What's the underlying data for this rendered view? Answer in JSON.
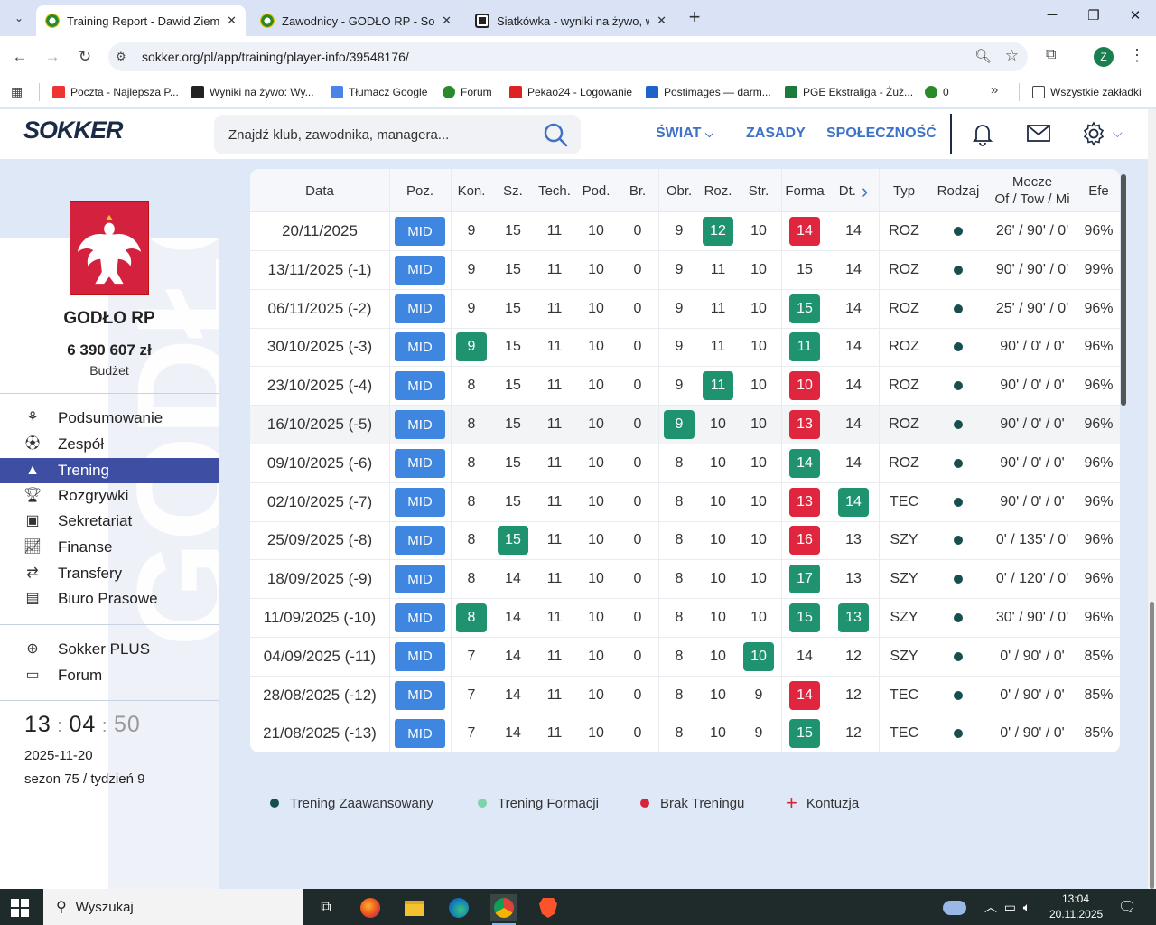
{
  "browser": {
    "tabs": [
      {
        "title": "Training Report - Dawid Ziemian",
        "active": true
      },
      {
        "title": "Zawodnicy - GODŁO RP - Sokker",
        "active": false
      },
      {
        "title": "Siatkówka - wyniki na żywo, wyn",
        "active": false
      }
    ],
    "url": "sokker.org/pl/app/training/player-info/39548176/",
    "profile_initial": "Z",
    "bookmarks": [
      "Poczta - Najlepsza P...",
      "Wyniki na żywo: Wy...",
      "Tłumacz Google",
      "Forum",
      "Pekao24 - Logowanie",
      "Postimages — darm...",
      "PGE Ekstraliga - Żuż...",
      "0"
    ],
    "all_bookmarks": "Wszystkie zakładki"
  },
  "header": {
    "logo": "SOKKER",
    "search_placeholder": "Znajdź klub, zawodnika, managera...",
    "nav": [
      "ŚWIAT",
      "ZASADY",
      "SPOŁECZNOŚĆ"
    ]
  },
  "sidebar": {
    "club_name": "GODŁO RP",
    "budget": "6 390 607 zł",
    "budget_label": "Budżet",
    "watermark": "GODŁO",
    "menu": [
      {
        "label": "Podsumowanie",
        "icon": "summary-icon"
      },
      {
        "label": "Zespół",
        "icon": "ball-icon"
      },
      {
        "label": "Trening",
        "icon": "cone-icon",
        "active": true
      },
      {
        "label": "Rozgrywki",
        "icon": "trophy-icon"
      },
      {
        "label": "Sekretariat",
        "icon": "briefcase-icon"
      },
      {
        "label": "Finanse",
        "icon": "chart-icon"
      },
      {
        "label": "Transfery",
        "icon": "arrows-icon"
      },
      {
        "label": "Biuro Prasowe",
        "icon": "newspaper-icon"
      }
    ],
    "menu2": [
      {
        "label": "Sokker PLUS",
        "icon": "plus-circle-icon"
      },
      {
        "label": "Forum",
        "icon": "chat-icon"
      }
    ],
    "clock": {
      "h": "13",
      "m": "04",
      "s": "50"
    },
    "date": "2025-11-20",
    "season": "sezon 75 / tydzień 9"
  },
  "table": {
    "headers": {
      "date": "Data",
      "pos": "Poz.",
      "kon": "Kon.",
      "sz": "Sz.",
      "tech": "Tech.",
      "pod": "Pod.",
      "br": "Br.",
      "obr": "Obr.",
      "roz": "Roz.",
      "str": "Str.",
      "forma": "Forma",
      "dt": "Dt.",
      "typ": "Typ",
      "rodzaj": "Rodzaj",
      "mecze1": "Mecze",
      "mecze2": "Of / Tow / Mi",
      "efe": "Efe"
    },
    "rows": [
      {
        "date": "20/11/2025",
        "pos": "MID",
        "kon": "9",
        "sz": "15",
        "tech": "11",
        "pod": "10",
        "br": "0",
        "obr": "9",
        "roz": "12",
        "str": "10",
        "forma": "14",
        "dt": "14",
        "typ": "ROZ",
        "mecze": "26' / 90' / 0'",
        "efe": "96%",
        "hl": {
          "roz": "g",
          "forma": "r"
        }
      },
      {
        "date": "13/11/2025 (-1)",
        "pos": "MID",
        "kon": "9",
        "sz": "15",
        "tech": "11",
        "pod": "10",
        "br": "0",
        "obr": "9",
        "roz": "11",
        "str": "10",
        "forma": "15",
        "dt": "14",
        "typ": "ROZ",
        "mecze": "90' / 90' / 0'",
        "efe": "99%",
        "hl": {}
      },
      {
        "date": "06/11/2025 (-2)",
        "pos": "MID",
        "kon": "9",
        "sz": "15",
        "tech": "11",
        "pod": "10",
        "br": "0",
        "obr": "9",
        "roz": "11",
        "str": "10",
        "forma": "15",
        "dt": "14",
        "typ": "ROZ",
        "mecze": "25' / 90' / 0'",
        "efe": "96%",
        "hl": {
          "forma": "g"
        }
      },
      {
        "date": "30/10/2025 (-3)",
        "pos": "MID",
        "kon": "9",
        "sz": "15",
        "tech": "11",
        "pod": "10",
        "br": "0",
        "obr": "9",
        "roz": "11",
        "str": "10",
        "forma": "11",
        "dt": "14",
        "typ": "ROZ",
        "mecze": "90' / 0' / 0'",
        "efe": "96%",
        "hl": {
          "kon": "g",
          "forma": "g"
        }
      },
      {
        "date": "23/10/2025 (-4)",
        "pos": "MID",
        "kon": "8",
        "sz": "15",
        "tech": "11",
        "pod": "10",
        "br": "0",
        "obr": "9",
        "roz": "11",
        "str": "10",
        "forma": "10",
        "dt": "14",
        "typ": "ROZ",
        "mecze": "90' / 0' / 0'",
        "efe": "96%",
        "hl": {
          "roz": "g",
          "forma": "r"
        }
      },
      {
        "date": "16/10/2025 (-5)",
        "pos": "MID",
        "kon": "8",
        "sz": "15",
        "tech": "11",
        "pod": "10",
        "br": "0",
        "obr": "9",
        "roz": "10",
        "str": "10",
        "forma": "13",
        "dt": "14",
        "typ": "ROZ",
        "mecze": "90' / 0' / 0'",
        "efe": "96%",
        "hl": {
          "obr": "g",
          "forma": "r"
        },
        "row_hl": true
      },
      {
        "date": "09/10/2025 (-6)",
        "pos": "MID",
        "kon": "8",
        "sz": "15",
        "tech": "11",
        "pod": "10",
        "br": "0",
        "obr": "8",
        "roz": "10",
        "str": "10",
        "forma": "14",
        "dt": "14",
        "typ": "ROZ",
        "mecze": "90' / 0' / 0'",
        "efe": "96%",
        "hl": {
          "forma": "g"
        }
      },
      {
        "date": "02/10/2025 (-7)",
        "pos": "MID",
        "kon": "8",
        "sz": "15",
        "tech": "11",
        "pod": "10",
        "br": "0",
        "obr": "8",
        "roz": "10",
        "str": "10",
        "forma": "13",
        "dt": "14",
        "typ": "TEC",
        "mecze": "90' / 0' / 0'",
        "efe": "96%",
        "hl": {
          "forma": "r",
          "dt": "g"
        }
      },
      {
        "date": "25/09/2025 (-8)",
        "pos": "MID",
        "kon": "8",
        "sz": "15",
        "tech": "11",
        "pod": "10",
        "br": "0",
        "obr": "8",
        "roz": "10",
        "str": "10",
        "forma": "16",
        "dt": "13",
        "typ": "SZY",
        "mecze": "0' / 135' / 0'",
        "efe": "96%",
        "hl": {
          "sz": "g",
          "forma": "r"
        }
      },
      {
        "date": "18/09/2025 (-9)",
        "pos": "MID",
        "kon": "8",
        "sz": "14",
        "tech": "11",
        "pod": "10",
        "br": "0",
        "obr": "8",
        "roz": "10",
        "str": "10",
        "forma": "17",
        "dt": "13",
        "typ": "SZY",
        "mecze": "0' / 120' / 0'",
        "efe": "96%",
        "hl": {
          "forma": "g"
        }
      },
      {
        "date": "11/09/2025 (-10)",
        "pos": "MID",
        "kon": "8",
        "sz": "14",
        "tech": "11",
        "pod": "10",
        "br": "0",
        "obr": "8",
        "roz": "10",
        "str": "10",
        "forma": "15",
        "dt": "13",
        "typ": "SZY",
        "mecze": "30' / 90' / 0'",
        "efe": "96%",
        "hl": {
          "kon": "g",
          "forma": "g",
          "dt": "g"
        }
      },
      {
        "date": "04/09/2025 (-11)",
        "pos": "MID",
        "kon": "7",
        "sz": "14",
        "tech": "11",
        "pod": "10",
        "br": "0",
        "obr": "8",
        "roz": "10",
        "str": "10",
        "forma": "14",
        "dt": "12",
        "typ": "SZY",
        "mecze": "0' / 90' / 0'",
        "efe": "85%",
        "hl": {
          "str": "g"
        }
      },
      {
        "date": "28/08/2025 (-12)",
        "pos": "MID",
        "kon": "7",
        "sz": "14",
        "tech": "11",
        "pod": "10",
        "br": "0",
        "obr": "8",
        "roz": "10",
        "str": "9",
        "forma": "14",
        "dt": "12",
        "typ": "TEC",
        "mecze": "0' / 90' / 0'",
        "efe": "85%",
        "hl": {
          "forma": "r"
        }
      },
      {
        "date": "21/08/2025 (-13)",
        "pos": "MID",
        "kon": "7",
        "sz": "14",
        "tech": "11",
        "pod": "10",
        "br": "0",
        "obr": "8",
        "roz": "10",
        "str": "9",
        "forma": "15",
        "dt": "12",
        "typ": "TEC",
        "mecze": "0' / 90' / 0'",
        "efe": "85%",
        "hl": {
          "forma": "g"
        }
      }
    ]
  },
  "legend": [
    {
      "label": "Trening Zaawansowany",
      "color": "#174f4e",
      "kind": "dot"
    },
    {
      "label": "Trening Formacji",
      "color": "#7fd3a8",
      "kind": "dot"
    },
    {
      "label": "Brak Treningu",
      "color": "#d6253a",
      "kind": "dot"
    },
    {
      "label": "Kontuzja",
      "color": "#d6253a",
      "kind": "plus"
    }
  ],
  "taskbar": {
    "search_label": "Wyszukaj",
    "time": "13:04",
    "date": "20.11.2025"
  }
}
